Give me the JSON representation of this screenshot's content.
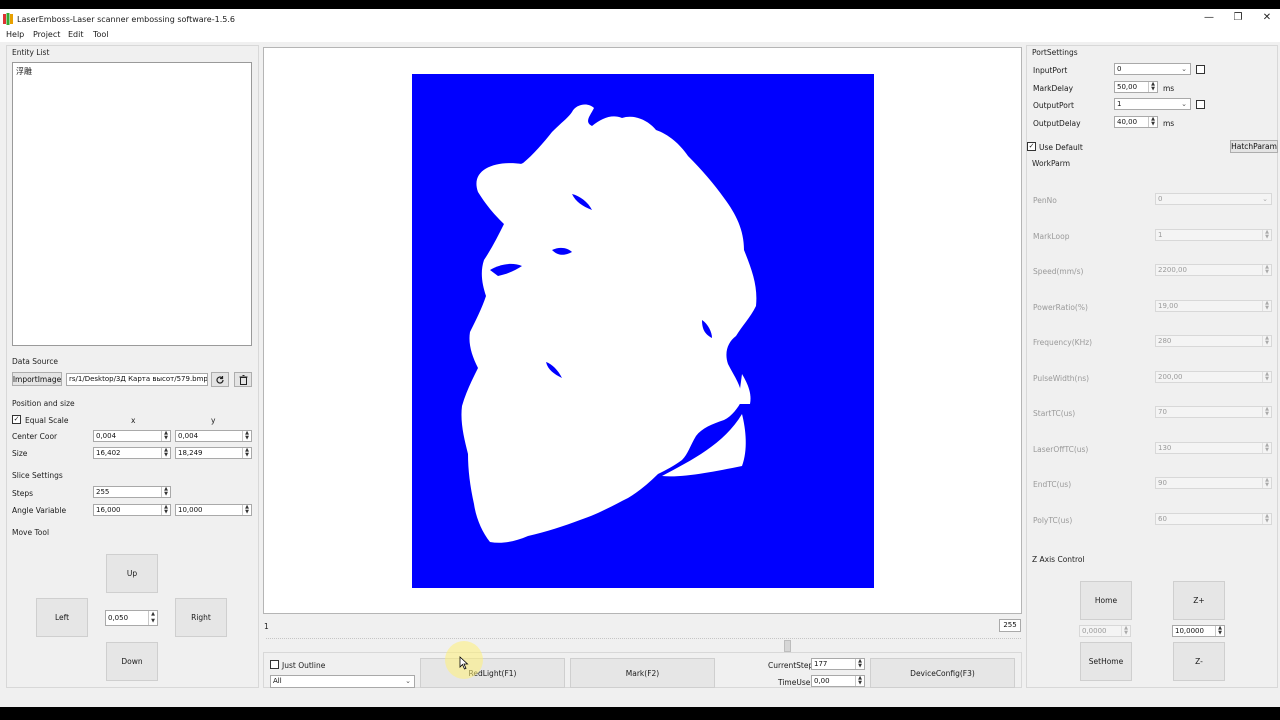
{
  "window": {
    "title": "LaserEmboss-Laser scanner embossing software-1.5.6",
    "controls": [
      "—",
      "❐",
      "✕"
    ]
  },
  "menu": [
    "Help",
    "Project",
    "Edit",
    "Tool"
  ],
  "entity_list": {
    "label": "Entity List",
    "items": [
      "浮雕"
    ]
  },
  "data_source": {
    "label": "Data Source",
    "import_button": "ImportImage",
    "path": "rs/1/Desktop/3Д Карта высот/579.bmp"
  },
  "position_size": {
    "label": "Position and size",
    "equal_scale": "Equal Scale",
    "col_x": "x",
    "col_y": "y",
    "center_label": "Center Coor",
    "center_x": "0,004",
    "center_y": "0,004",
    "size_label": "Size",
    "size_x": "16,402",
    "size_y": "18,249"
  },
  "slice": {
    "label": "Slice Settings",
    "steps_label": "Steps",
    "steps": "255",
    "angle_label": "Angle Variable",
    "angle_x": "16,000",
    "angle_y": "10,000"
  },
  "move_tool": {
    "label": "Move Tool",
    "up": "Up",
    "left": "Left",
    "right": "Right",
    "down": "Down",
    "step": "0,050"
  },
  "canvas": {
    "background_color": "#0000ff",
    "slider_min": "1",
    "slider_max": "255"
  },
  "bottom_bar": {
    "just_outline": "Just Outline",
    "filter": "All",
    "redlight": "RedLight(F1)",
    "mark": "Mark(F2)",
    "current_step_label": "CurrentStep",
    "current_step": "177",
    "time_use_label": "TimeUse",
    "time_use": "0,00",
    "device_config": "DeviceConfig(F3)"
  },
  "port_settings": {
    "label": "PortSettings",
    "input_port_label": "InputPort",
    "input_port": "0",
    "mark_delay_label": "MarkDelay",
    "mark_delay": "50,00",
    "output_port_label": "OutputPort",
    "output_port": "1",
    "output_delay_label": "OutputDelay",
    "output_delay": "40,00",
    "unit": "ms"
  },
  "work_param": {
    "use_default": "Use Default",
    "hatch_button": "HatchParam",
    "label": "WorkParm",
    "rows": [
      {
        "name": "PenNo",
        "value": "0",
        "combo": true
      },
      {
        "name": "MarkLoop",
        "value": "1"
      },
      {
        "name": "Speed(mm/s)",
        "value": "2200,00"
      },
      {
        "name": "PowerRatio(%)",
        "value": "19,00"
      },
      {
        "name": "Frequency(KHz)",
        "value": "280"
      },
      {
        "name": "PulseWidth(ns)",
        "value": "200,00"
      },
      {
        "name": "StartTC(us)",
        "value": "70"
      },
      {
        "name": "LaserOffTC(us)",
        "value": "130"
      },
      {
        "name": "EndTC(us)",
        "value": "90"
      },
      {
        "name": "PolyTC(us)",
        "value": "60"
      }
    ]
  },
  "z_axis": {
    "label": "Z Axis Control",
    "home": "Home",
    "z_plus": "Z+",
    "z_minus": "Z-",
    "set_home": "SetHome",
    "pos_value": "0,0000",
    "step_value": "10,0000"
  }
}
